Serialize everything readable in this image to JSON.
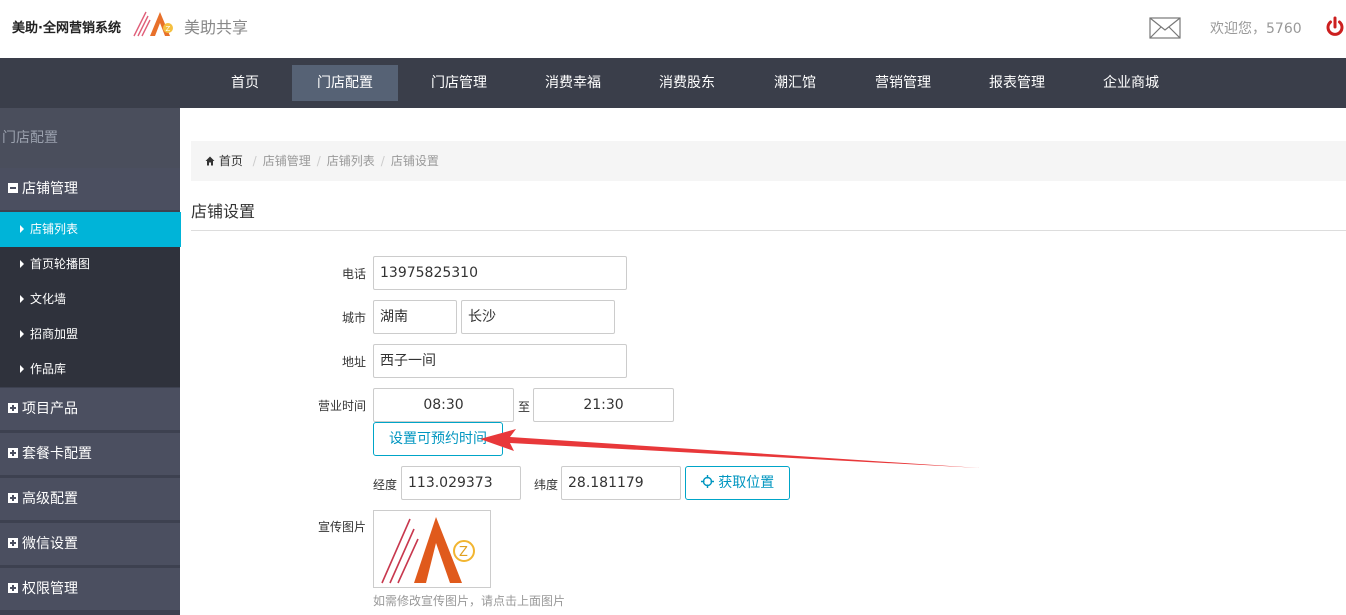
{
  "header": {
    "brand": "美助·全网营销系统",
    "brand_sub": "美助共享",
    "welcome": "欢迎您，5760",
    "icons": [
      "logo-icon",
      "mail-icon",
      "power-icon"
    ],
    "power_color": "#cc1f1f"
  },
  "nav": {
    "items": [
      "首页",
      "门店配置",
      "门店管理",
      "消费幸福",
      "消费股东",
      "潮汇馆",
      "营销管理",
      "报表管理",
      "企业商城"
    ],
    "active": "门店配置"
  },
  "sidebar": {
    "title": "门店配置",
    "groups": [
      {
        "label": "店铺管理",
        "expanded": true,
        "items": [
          "店铺列表",
          "首页轮播图",
          "文化墙",
          "招商加盟",
          "作品库"
        ],
        "active": "店铺列表"
      },
      {
        "label": "项目产品",
        "expanded": false
      },
      {
        "label": "套餐卡配置",
        "expanded": false
      },
      {
        "label": "高级配置",
        "expanded": false
      },
      {
        "label": "微信设置",
        "expanded": false
      },
      {
        "label": "权限管理",
        "expanded": false
      }
    ],
    "accent": "#00b4d8"
  },
  "breadcrumb": [
    "首页",
    "店铺管理",
    "店铺列表",
    "店铺设置"
  ],
  "page_title": "店铺设置",
  "form": {
    "phone_label": "电话",
    "phone": "13975825310",
    "city_label": "城市",
    "province": "湖南",
    "city": "长沙",
    "address_label": "地址",
    "address": "西子一间",
    "hours_label": "营业时间",
    "open_time": "08:30",
    "to": "至",
    "close_time": "21:30",
    "reserve_btn": "设置可预约时间",
    "lng_label": "经度",
    "lng": "113.029373",
    "lat_label": "纬度",
    "lat": "28.181179",
    "locate_btn": "获取位置",
    "promo_label": "宣传图片",
    "promo_hint": "如需修改宣传图片，请点击上面图片"
  }
}
